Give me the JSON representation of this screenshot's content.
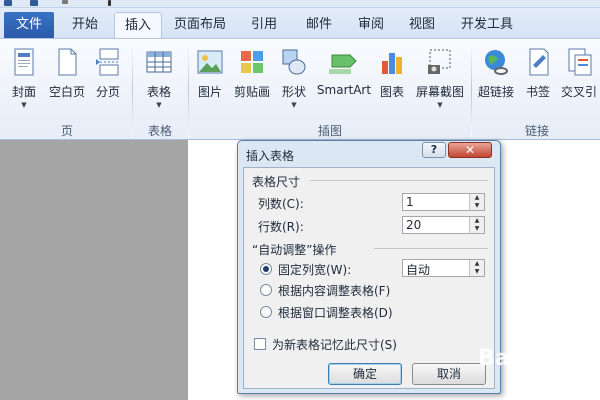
{
  "ribbon_tabs": [
    "文件",
    "开始",
    "插入",
    "页面布局",
    "引用",
    "邮件",
    "审阅",
    "视图",
    "开发工具"
  ],
  "active_tab": "插入",
  "ribbon": {
    "groups": {
      "pages": "页",
      "tables": "表格",
      "illustrations": "插图",
      "links": "链接"
    },
    "buttons": {
      "cover": "封面",
      "blank_page": "空白页",
      "page_break": "分页",
      "table": "表格",
      "picture": "图片",
      "clip_art": "剪贴画",
      "shapes": "形状",
      "smartart": "SmartArt",
      "chart": "图表",
      "screenshot": "屏幕截图",
      "hyperlink": "超链接",
      "bookmark": "书签",
      "cross_ref": "交叉引"
    }
  },
  "dialog": {
    "title": "插入表格",
    "help": "?",
    "close": "✕",
    "size_section": "表格尺寸",
    "columns_label": "列数(C):",
    "columns_value": "1",
    "rows_label": "行数(R):",
    "rows_value": "20",
    "autofit_section": "“自动调整”操作",
    "fixed_label": "固定列宽(W):",
    "fixed_value": "自动",
    "content_label": "根据内容调整表格(F)",
    "window_label": "根据窗口调整表格(D)",
    "remember_label": "为新表格记忆此尺寸(S)",
    "ok": "确定",
    "cancel": "取消"
  },
  "watermark": "Bai 经验",
  "colors": {
    "file_tab": "#2a5aa8",
    "dialog_frame": "#dce7f4",
    "close_button": "#c24535"
  }
}
